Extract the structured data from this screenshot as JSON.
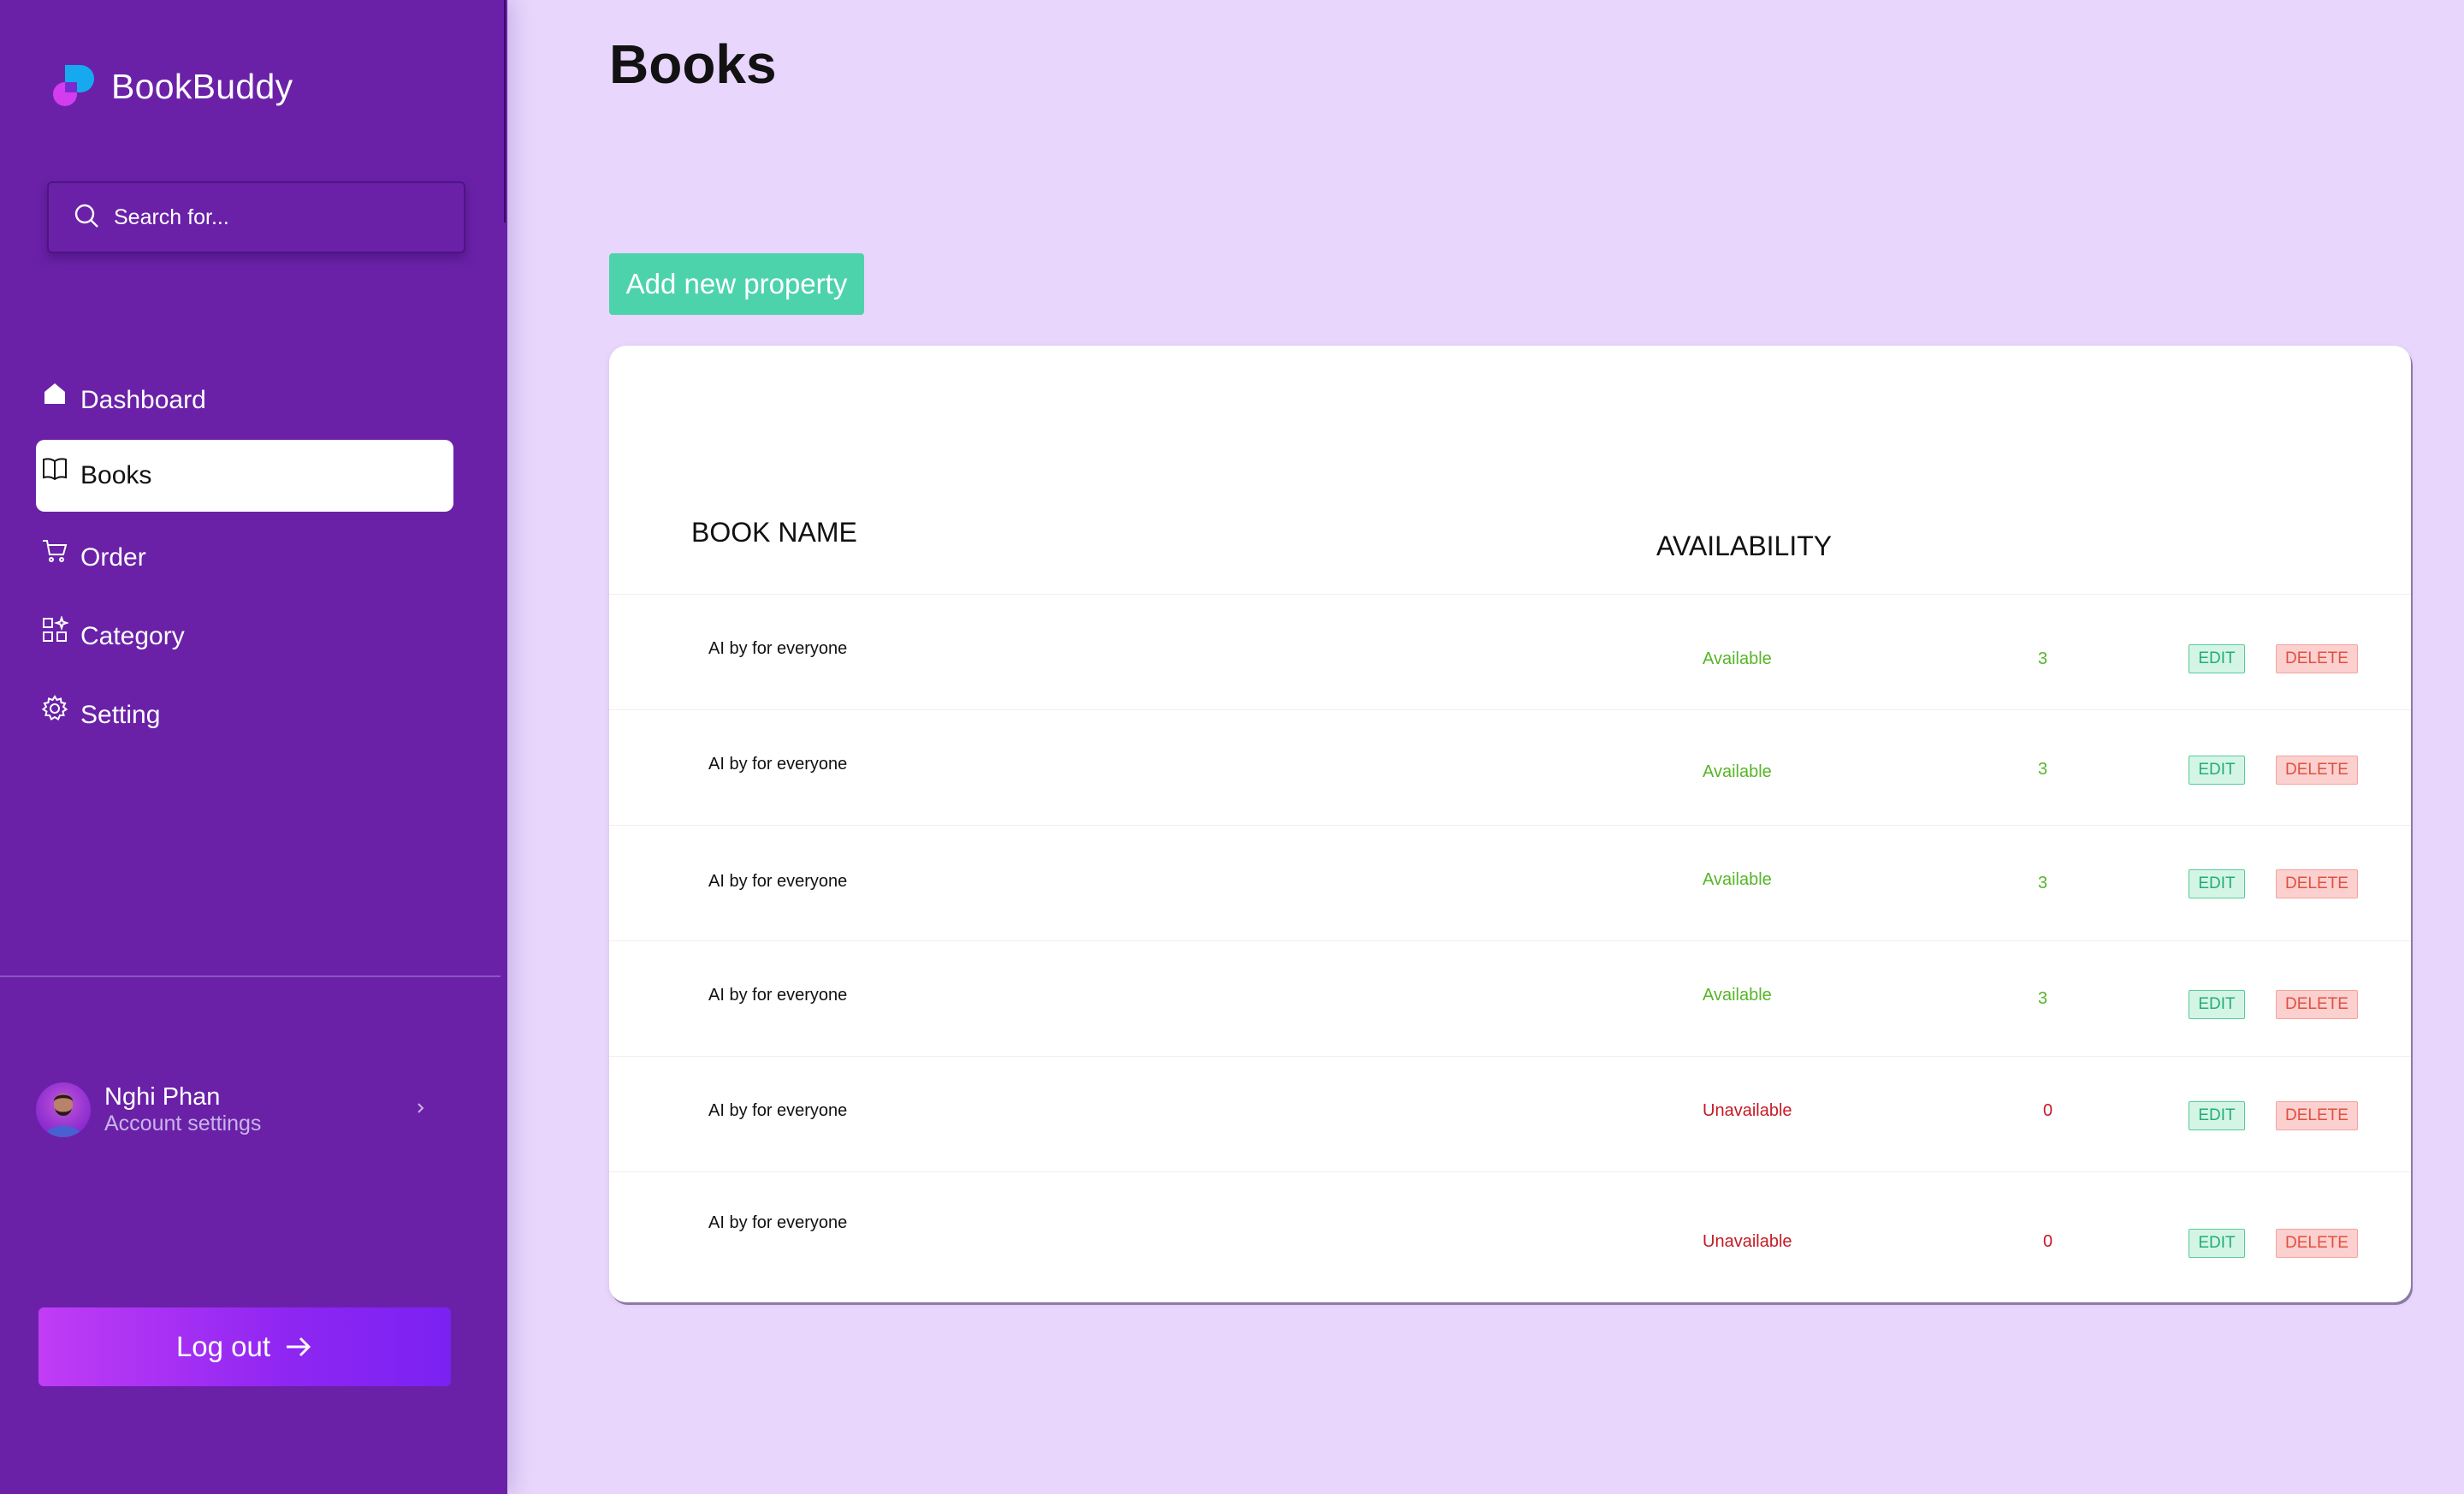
{
  "app": {
    "name": "BookBuddy"
  },
  "search": {
    "placeholder": "Search for..."
  },
  "nav": {
    "items": [
      {
        "label": "Dashboard",
        "icon": "home-icon"
      },
      {
        "label": "Books",
        "icon": "book-icon",
        "active": true
      },
      {
        "label": "Order",
        "icon": "cart-icon"
      },
      {
        "label": "Category",
        "icon": "category-icon"
      },
      {
        "label": "Setting",
        "icon": "gear-icon"
      }
    ]
  },
  "user": {
    "name": "Nghi Phan",
    "subtitle": "Account settings"
  },
  "logout": {
    "label": "Log out"
  },
  "page": {
    "title": "Books",
    "add_button": "Add new property"
  },
  "table": {
    "headers": {
      "name": "BOOK NAME",
      "availability": "AVAILABILITY"
    },
    "actions": {
      "edit": "EDIT",
      "delete": "DELETE"
    },
    "rows": [
      {
        "name": "AI by for everyone",
        "status": "Available",
        "qty": "3"
      },
      {
        "name": "AI by for everyone",
        "status": "Available",
        "qty": "3"
      },
      {
        "name": "AI by for everyone",
        "status": "Available",
        "qty": "3"
      },
      {
        "name": "AI by for everyone",
        "status": "Available",
        "qty": "3"
      },
      {
        "name": "AI by for everyone",
        "status": "Unavailable",
        "qty": "0"
      },
      {
        "name": "AI by for everyone",
        "status": "Unavailable",
        "qty": "0"
      }
    ]
  },
  "colors": {
    "sidebar": "#6a21a8",
    "background": "#e8d6fd",
    "accent_green": "#4dd3ac",
    "available": "#57b528",
    "unavailable": "#c51a24"
  }
}
